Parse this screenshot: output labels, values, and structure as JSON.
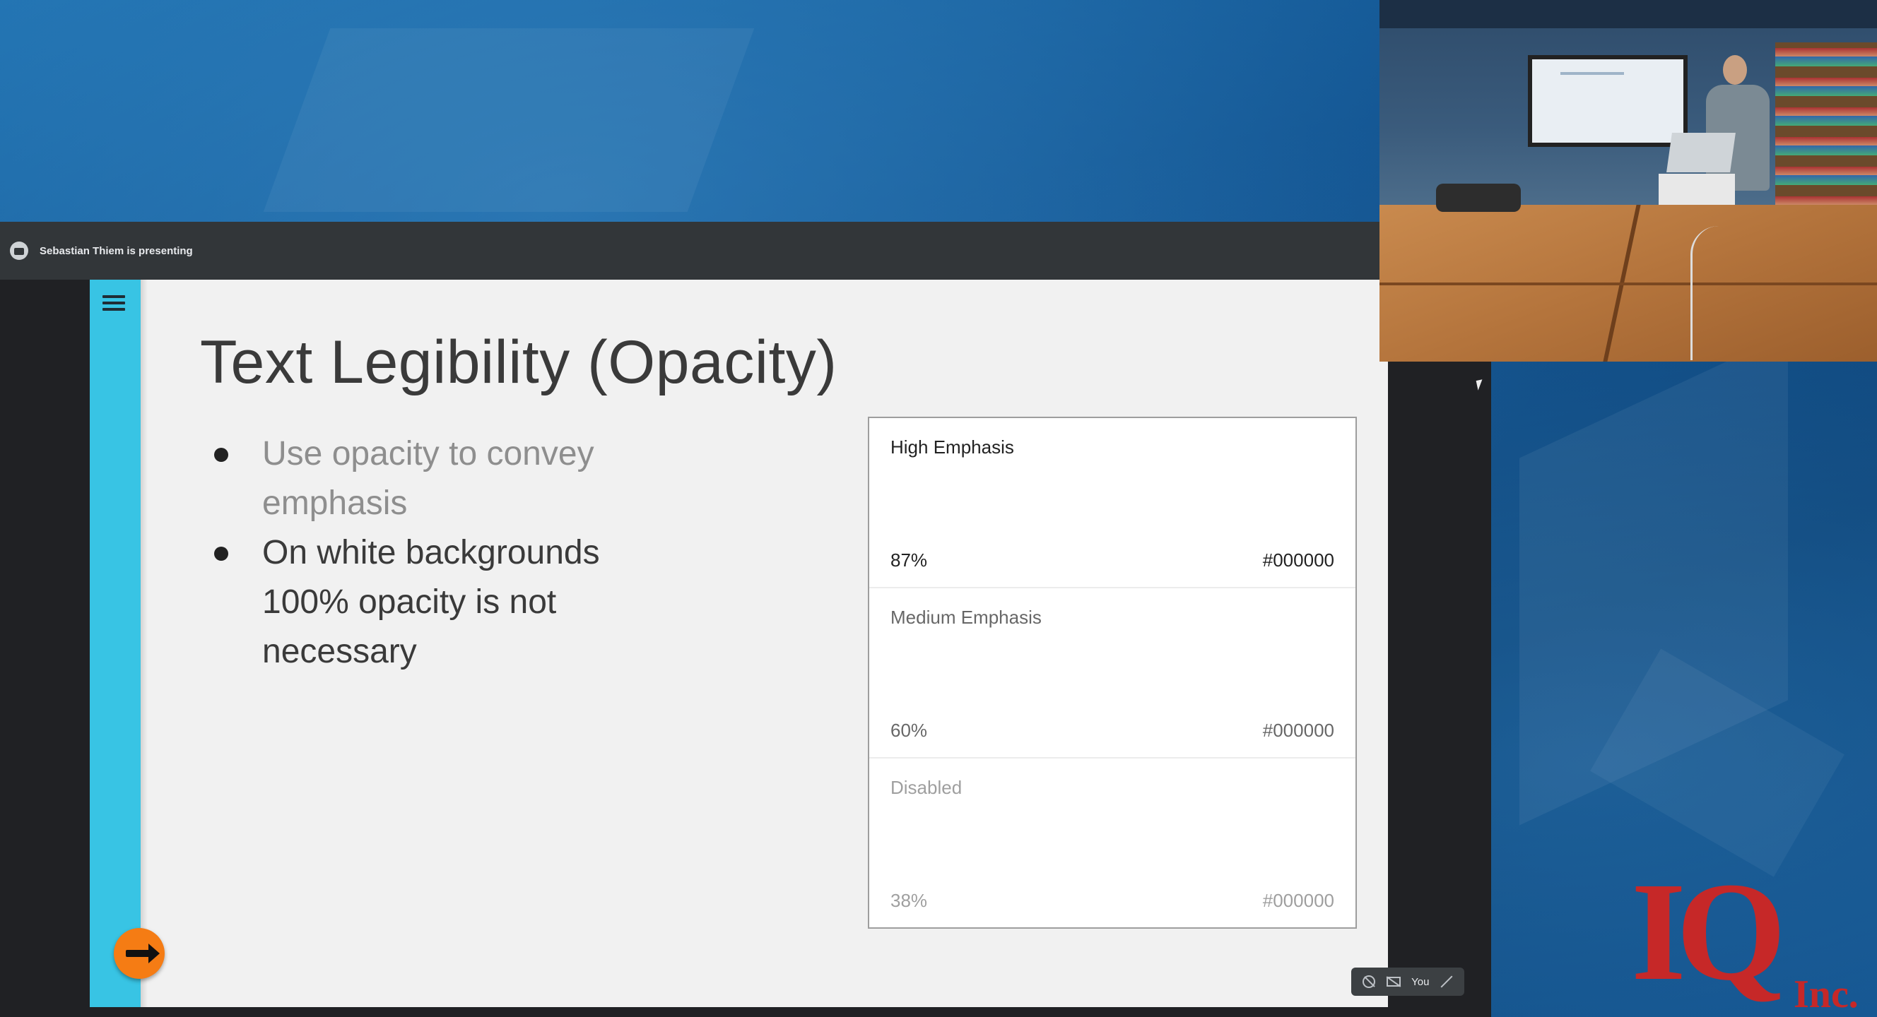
{
  "meeting": {
    "presenter_banner": "Sebastian Thiem is presenting",
    "self_view_label": "You"
  },
  "slide": {
    "title": "Text Legibility (Opacity)",
    "bullets": [
      {
        "text": "Use opacity to convey emphasis"
      },
      {
        "text": "On white backgrounds 100% opacity is not necessary"
      }
    ],
    "emphasis_table": [
      {
        "label": "High Emphasis",
        "opacity": "87%",
        "color": "#000000"
      },
      {
        "label": "Medium Emphasis",
        "opacity": "60%",
        "color": "#000000"
      },
      {
        "label": "Disabled",
        "opacity": "38%",
        "color": "#000000"
      }
    ]
  },
  "logo": {
    "mark": "IQ",
    "suffix": "Inc."
  },
  "colors": {
    "slide_accent": "#38c4e4",
    "next_button": "#f57c14",
    "logo_red": "#c62828"
  },
  "icons": {
    "menu": "hamburger-icon",
    "next": "arrow-right-icon",
    "mic": "mic-off-icon",
    "camera": "camera-off-icon",
    "expand": "expand-icon"
  }
}
